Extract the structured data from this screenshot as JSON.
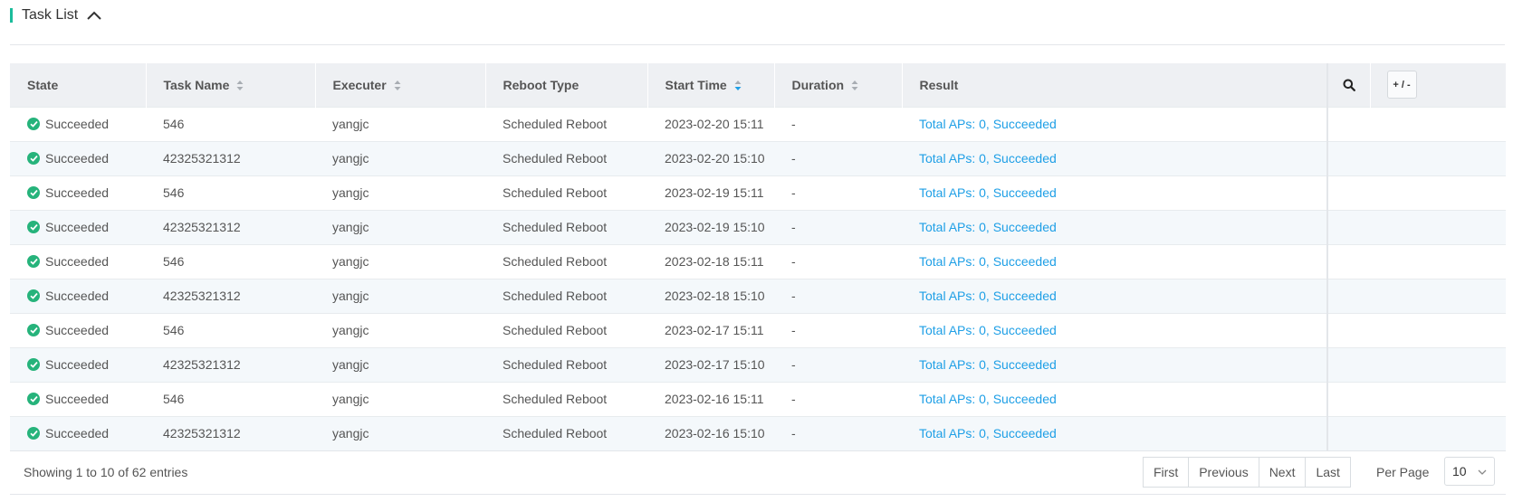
{
  "section": {
    "title": "Task List"
  },
  "table": {
    "columns": [
      {
        "key": "state",
        "label": "State",
        "sortable": false
      },
      {
        "key": "task_name",
        "label": "Task Name",
        "sortable": true
      },
      {
        "key": "executer",
        "label": "Executer",
        "sortable": true
      },
      {
        "key": "reboot_type",
        "label": "Reboot Type",
        "sortable": false
      },
      {
        "key": "start_time",
        "label": "Start Time",
        "sortable": true,
        "sorted": "desc"
      },
      {
        "key": "duration",
        "label": "Duration",
        "sortable": true
      },
      {
        "key": "result",
        "label": "Result",
        "sortable": false
      }
    ],
    "toggle_label": "+ / -",
    "rows": [
      {
        "state": "Succeeded",
        "task_name": "546",
        "executer": "yangjc",
        "reboot_type": "Scheduled Reboot",
        "start_time": "2023-02-20 15:11",
        "duration": "-",
        "result": "Total APs: 0, Succeeded"
      },
      {
        "state": "Succeeded",
        "task_name": "42325321312",
        "executer": "yangjc",
        "reboot_type": "Scheduled Reboot",
        "start_time": "2023-02-20 15:10",
        "duration": "-",
        "result": "Total APs: 0, Succeeded"
      },
      {
        "state": "Succeeded",
        "task_name": "546",
        "executer": "yangjc",
        "reboot_type": "Scheduled Reboot",
        "start_time": "2023-02-19 15:11",
        "duration": "-",
        "result": "Total APs: 0, Succeeded"
      },
      {
        "state": "Succeeded",
        "task_name": "42325321312",
        "executer": "yangjc",
        "reboot_type": "Scheduled Reboot",
        "start_time": "2023-02-19 15:10",
        "duration": "-",
        "result": "Total APs: 0, Succeeded"
      },
      {
        "state": "Succeeded",
        "task_name": "546",
        "executer": "yangjc",
        "reboot_type": "Scheduled Reboot",
        "start_time": "2023-02-18 15:11",
        "duration": "-",
        "result": "Total APs: 0, Succeeded"
      },
      {
        "state": "Succeeded",
        "task_name": "42325321312",
        "executer": "yangjc",
        "reboot_type": "Scheduled Reboot",
        "start_time": "2023-02-18 15:10",
        "duration": "-",
        "result": "Total APs: 0, Succeeded"
      },
      {
        "state": "Succeeded",
        "task_name": "546",
        "executer": "yangjc",
        "reboot_type": "Scheduled Reboot",
        "start_time": "2023-02-17 15:11",
        "duration": "-",
        "result": "Total APs: 0, Succeeded"
      },
      {
        "state": "Succeeded",
        "task_name": "42325321312",
        "executer": "yangjc",
        "reboot_type": "Scheduled Reboot",
        "start_time": "2023-02-17 15:10",
        "duration": "-",
        "result": "Total APs: 0, Succeeded"
      },
      {
        "state": "Succeeded",
        "task_name": "546",
        "executer": "yangjc",
        "reboot_type": "Scheduled Reboot",
        "start_time": "2023-02-16 15:11",
        "duration": "-",
        "result": "Total APs: 0, Succeeded"
      },
      {
        "state": "Succeeded",
        "task_name": "42325321312",
        "executer": "yangjc",
        "reboot_type": "Scheduled Reboot",
        "start_time": "2023-02-16 15:10",
        "duration": "-",
        "result": "Total APs: 0, Succeeded"
      }
    ]
  },
  "footer": {
    "entries_text": "Showing 1 to 10 of 62 entries",
    "pager": {
      "first": "First",
      "previous": "Previous",
      "next": "Next",
      "last": "Last"
    },
    "per_page_label": "Per Page",
    "per_page_value": "10"
  },
  "icons": {
    "collapse": "chevron-up-icon",
    "search": "search-icon",
    "state": "check-circle-icon",
    "sort": "sort-icon",
    "dropdown": "chevron-down-icon"
  },
  "colors": {
    "accent": "#1bbc9b",
    "success": "#26b37b",
    "link": "#1e9fe6",
    "header_bg": "#eef0f3"
  }
}
